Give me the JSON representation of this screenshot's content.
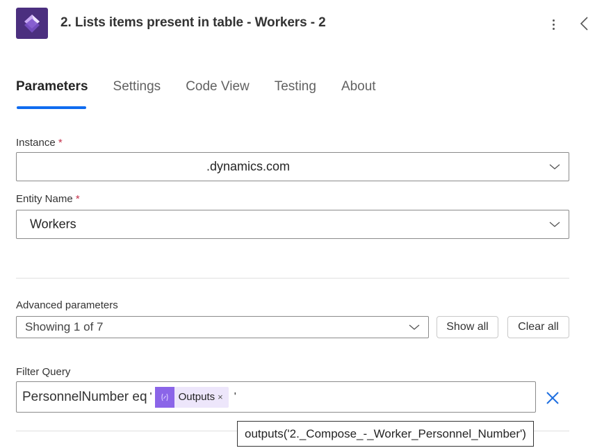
{
  "header": {
    "title": "2. Lists items present in table - Workers - 2",
    "app_icon": "power-automate-dataverse-icon",
    "more_icon": "more-vertical-icon",
    "collapse_icon": "chevron-left-icon"
  },
  "tabs": [
    {
      "label": "Parameters",
      "active": true
    },
    {
      "label": "Settings",
      "active": false
    },
    {
      "label": "Code View",
      "active": false
    },
    {
      "label": "Testing",
      "active": false
    },
    {
      "label": "About",
      "active": false
    }
  ],
  "fields": {
    "instance": {
      "label": "Instance",
      "required_mark": "*",
      "value": ".dynamics.com"
    },
    "entity_name": {
      "label": "Entity Name",
      "required_mark": "*",
      "value": "Workers"
    }
  },
  "advanced": {
    "label": "Advanced parameters",
    "value": "Showing 1 of 7",
    "show_all": "Show all",
    "clear_all": "Clear all"
  },
  "filter_query": {
    "label": "Filter Query",
    "prefix_text": "PersonnelNumber eq",
    "open_quote": "'",
    "token_label": "Outputs",
    "token_remove": "×",
    "close_quote": "'",
    "tooltip": "outputs('2._Compose_-_Worker_Personnel_Number')"
  },
  "colors": {
    "accent": "#0f6cf0",
    "app_icon_bg": "#4b2f7f",
    "token_bg": "#ede6fb",
    "token_icon_bg": "#8b65e8",
    "required": "#c4314b"
  }
}
